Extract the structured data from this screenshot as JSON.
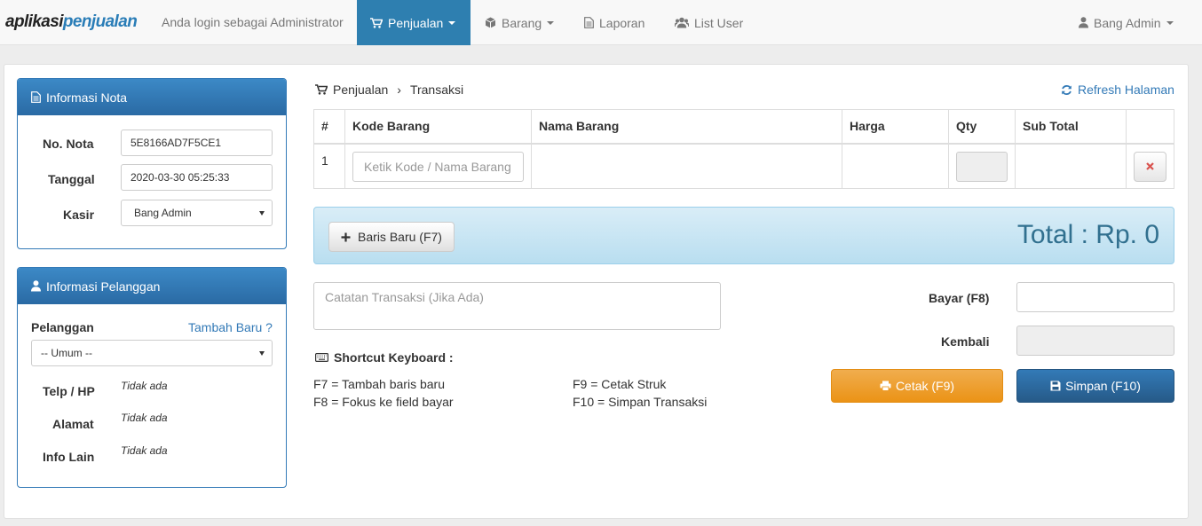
{
  "navbar": {
    "brand_part1": "aplikasi",
    "brand_part2": "penjualan",
    "login_text": "Anda login sebagai Administrator",
    "items": [
      {
        "label": "Penjualan",
        "icon": "cart-icon"
      },
      {
        "label": "Barang",
        "icon": "cube-icon"
      },
      {
        "label": "Laporan",
        "icon": "file-icon"
      },
      {
        "label": "List User",
        "icon": "users-icon"
      }
    ],
    "user_label": "Bang Admin"
  },
  "nota": {
    "title": "Informasi Nota",
    "no_label": "No. Nota",
    "no_value": "5E8166AD7F5CE1",
    "tanggal_label": "Tanggal",
    "tanggal_value": "2020-03-30 05:25:33",
    "kasir_label": "Kasir",
    "kasir_value": "Bang Admin"
  },
  "pelanggan": {
    "title": "Informasi Pelanggan",
    "label": "Pelanggan",
    "add_link": "Tambah Baru ?",
    "select_value": "-- Umum --",
    "telp_label": "Telp / HP",
    "telp_value": "Tidak ada",
    "alamat_label": "Alamat",
    "alamat_value": "Tidak ada",
    "info_label": "Info Lain",
    "info_value": "Tidak ada"
  },
  "breadcrumb": {
    "first": "Penjualan",
    "sep": "›",
    "second": "Transaksi"
  },
  "refresh_label": "Refresh Halaman",
  "table": {
    "headers": [
      "#",
      "Kode Barang",
      "Nama Barang",
      "Harga",
      "Qty",
      "Sub Total"
    ],
    "row_num": "1",
    "kode_placeholder": "Ketik Kode / Nama Barang"
  },
  "add_row_label": "Baris Baru (F7)",
  "total_label": "Total : Rp. 0",
  "catatan_placeholder": "Catatan Transaksi (Jika Ada)",
  "bayar_label": "Bayar (F8)",
  "kembali_label": "Kembali",
  "shortcut": {
    "title": "Shortcut Keyboard :",
    "items": [
      "F7 = Tambah baris baru",
      "F8 = Fokus ke field bayar",
      "F9 = Cetak Struk",
      "F10 = Simpan Transaksi"
    ]
  },
  "cetak_label": "Cetak (F9)",
  "simpan_label": "Simpan (F10)",
  "colors": {
    "primary": "#337ab7",
    "warning": "#f0ad4e",
    "danger": "#d9534f",
    "nav_active": "#2e7fb0"
  }
}
